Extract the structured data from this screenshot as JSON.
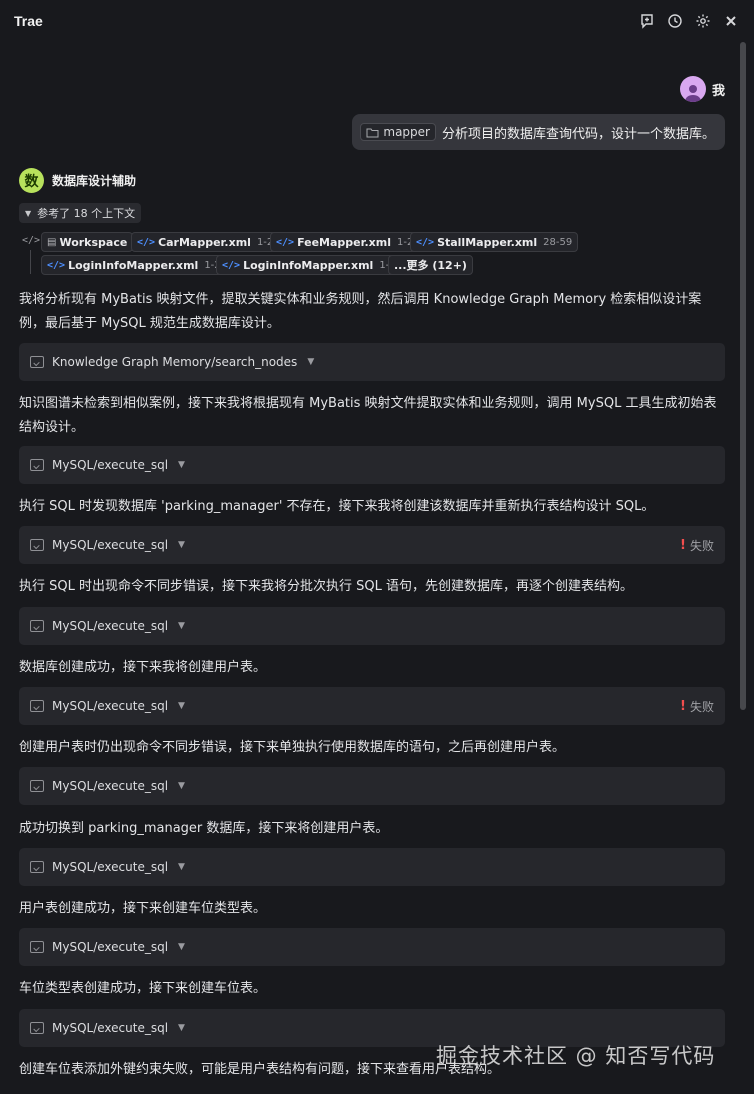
{
  "app": {
    "title": "Trae"
  },
  "user": {
    "name": "我"
  },
  "user_message": {
    "chip": "mapper",
    "text": "分析项目的数据库查询代码，设计一个数据库。"
  },
  "agent": {
    "avatar_char": "数",
    "name": "数据库设计辅助"
  },
  "references": {
    "toggle_label": "参考了 18 个上下文",
    "chips": [
      {
        "label": "Workspace",
        "range": ""
      },
      {
        "label": "CarMapper.xml",
        "range": "1-23"
      },
      {
        "label": "FeeMapper.xml",
        "range": "1-21"
      },
      {
        "label": "StallMapper.xml",
        "range": "28-59"
      },
      {
        "label": "LoginInfoMapper.xml",
        "range": "1-22"
      },
      {
        "label": "LoginInfoMapper.xml",
        "range": "1-22"
      },
      {
        "label": "...更多 (12+)",
        "range": ""
      }
    ]
  },
  "paragraphs": [
    "我将分析现有 MyBatis 映射文件，提取关键实体和业务规则，然后调用 Knowledge Graph Memory 检索相似设计案例，最后基于 MySQL 规范生成数据库设计。",
    "知识图谱未检索到相似案例，接下来我将根据现有 MyBatis 映射文件提取实体和业务规则，调用 MySQL 工具生成初始表结构设计。",
    "执行 SQL 时发现数据库 'parking_manager' 不存在，接下来我将创建该数据库并重新执行表结构设计 SQL。",
    "执行 SQL 时出现命令不同步错误，接下来我将分批次执行 SQL 语句，先创建数据库，再逐个创建表结构。",
    "数据库创建成功，接下来我将创建用户表。",
    "创建用户表时仍出现命令不同步错误，接下来单独执行使用数据库的语句，之后再创建用户表。",
    "成功切换到 parking_manager 数据库，接下来将创建用户表。",
    "用户表创建成功，接下来创建车位类型表。",
    "车位类型表创建成功，接下来创建车位表。",
    "创建车位表添加外键约束失败，可能是用户表结构有问题，接下来查看用户表结构。"
  ],
  "tools": [
    {
      "name": "Knowledge Graph Memory/search_nodes",
      "status": ""
    },
    {
      "name": "MySQL/execute_sql",
      "status": ""
    },
    {
      "name": "MySQL/execute_sql",
      "status": "失败"
    },
    {
      "name": "MySQL/execute_sql",
      "status": ""
    },
    {
      "name": "MySQL/execute_sql",
      "status": "失败"
    },
    {
      "name": "MySQL/execute_sql",
      "status": ""
    },
    {
      "name": "MySQL/execute_sql",
      "status": ""
    },
    {
      "name": "MySQL/execute_sql",
      "status": ""
    },
    {
      "name": "MySQL/execute_sql",
      "status": ""
    }
  ],
  "watermark": "掘金技术社区 @ 知否写代码",
  "icons": {
    "header": [
      "new-chat-icon",
      "history-icon",
      "gear-icon",
      "close-icon"
    ],
    "tool": "tool-icon",
    "fail": "error-icon"
  },
  "colors": {
    "background": "#18191d",
    "card": "#26272c",
    "accent_link": "#4d8fff",
    "error": "#f24e4e",
    "agent_avatar": "#b7e15c"
  }
}
